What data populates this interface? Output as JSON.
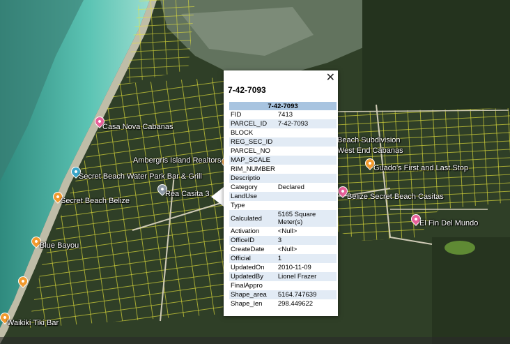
{
  "map": {
    "places": [
      {
        "name": "Casa Nova Cabanas",
        "color": "#e8619a"
      },
      {
        "name": "Ambergris Island Realtors",
        "color": "#f29a2e"
      },
      {
        "name": "Secret Beach Water Park Bar & Grill",
        "color": "#3aa6c9"
      },
      {
        "name": "Rea Casita 3",
        "color": "#8e9aa6"
      },
      {
        "name": "Secret Beach Belize",
        "color": "#f29a2e"
      },
      {
        "name": "Blue Bayou",
        "color": "#f29a2e"
      },
      {
        "name": "Waikiki Tiki Bar",
        "color": "#f29a2e"
      },
      {
        "name": "Beach Subdivision",
        "color": "#f29a2e"
      },
      {
        "name": "West End Cabanas",
        "color": "#f29a2e"
      },
      {
        "name": "Guado's First and Last Stop",
        "color": "#f29a2e"
      },
      {
        "name": "Belize Secret Beach Casitas",
        "color": "#e8619a"
      },
      {
        "name": "El Fin Del Mundo",
        "color": "#e8619a"
      }
    ]
  },
  "popup": {
    "title": "7-42-7093",
    "table_header": "7-42-7093",
    "close_symbol": "✕",
    "rows": [
      {
        "k": "FID",
        "v": "7413"
      },
      {
        "k": "PARCEL_ID",
        "v": "7-42-7093"
      },
      {
        "k": "BLOCK",
        "v": ""
      },
      {
        "k": "REG_SEC_ID",
        "v": ""
      },
      {
        "k": "PARCEL_NO",
        "v": ""
      },
      {
        "k": "MAP_SCALE",
        "v": ""
      },
      {
        "k": "RIM_NUMBER",
        "v": ""
      },
      {
        "k": "Descriptio",
        "v": ""
      },
      {
        "k": "Category",
        "v": "Declared"
      },
      {
        "k": "LandUse",
        "v": ""
      },
      {
        "k": "Type",
        "v": ""
      },
      {
        "k": "Calculated",
        "v": "5165 Square Meter(s)"
      },
      {
        "k": "Activation",
        "v": "<Null>"
      },
      {
        "k": "OfficeID",
        "v": "3"
      },
      {
        "k": "CreateDate",
        "v": "<Null>"
      },
      {
        "k": "Official",
        "v": "1"
      },
      {
        "k": "UpdatedOn",
        "v": "2010-11-09"
      },
      {
        "k": "UpdatedBy",
        "v": "Lionel Frazer"
      },
      {
        "k": "FinalAppro",
        "v": ""
      },
      {
        "k": "Shape_area",
        "v": "5164.747639"
      },
      {
        "k": "Shape_len",
        "v": "298.449622"
      }
    ]
  }
}
